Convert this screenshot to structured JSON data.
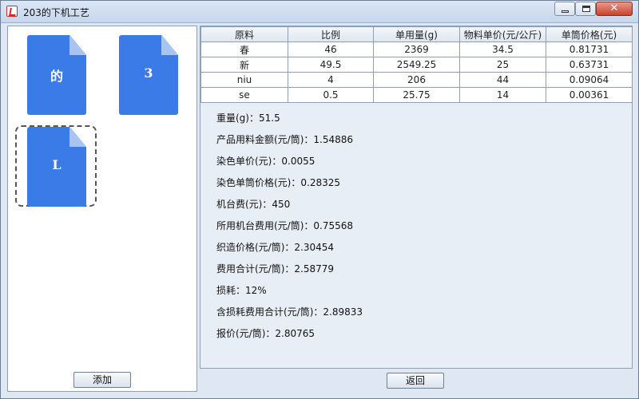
{
  "window": {
    "title": "203的下机工艺"
  },
  "files": [
    {
      "label": "的",
      "selected": false
    },
    {
      "label": "3",
      "selected": false
    },
    {
      "label": "L",
      "selected": true
    }
  ],
  "buttons": {
    "add": "添加",
    "back": "返回"
  },
  "table": {
    "headers": [
      "原料",
      "比例",
      "单用量(g)",
      "物料单价(元/公斤)",
      "单筒价格(元)"
    ],
    "rows": [
      [
        "春",
        "46",
        "2369",
        "34.5",
        "0.81731"
      ],
      [
        "新",
        "49.5",
        "2549.25",
        "25",
        "0.63731"
      ],
      [
        "niu",
        "4",
        "206",
        "44",
        "0.09064"
      ],
      [
        "se",
        "0.5",
        "25.75",
        "14",
        "0.00361"
      ]
    ]
  },
  "info": [
    "重量(g)：51.5",
    "产品用料金额(元/筒)：1.54886",
    "染色单价(元)：0.0055",
    "染色单筒价格(元)：0.28325",
    "机台费(元)：450",
    "所用机台费用(元/筒)：0.75568",
    "织造价格(元/筒)：2.30454",
    "费用合计(元/筒)：2.58779",
    "损耗：12%",
    "含损耗费用合计(元/筒)：2.89833",
    "报价(元/筒)：2.80765"
  ]
}
